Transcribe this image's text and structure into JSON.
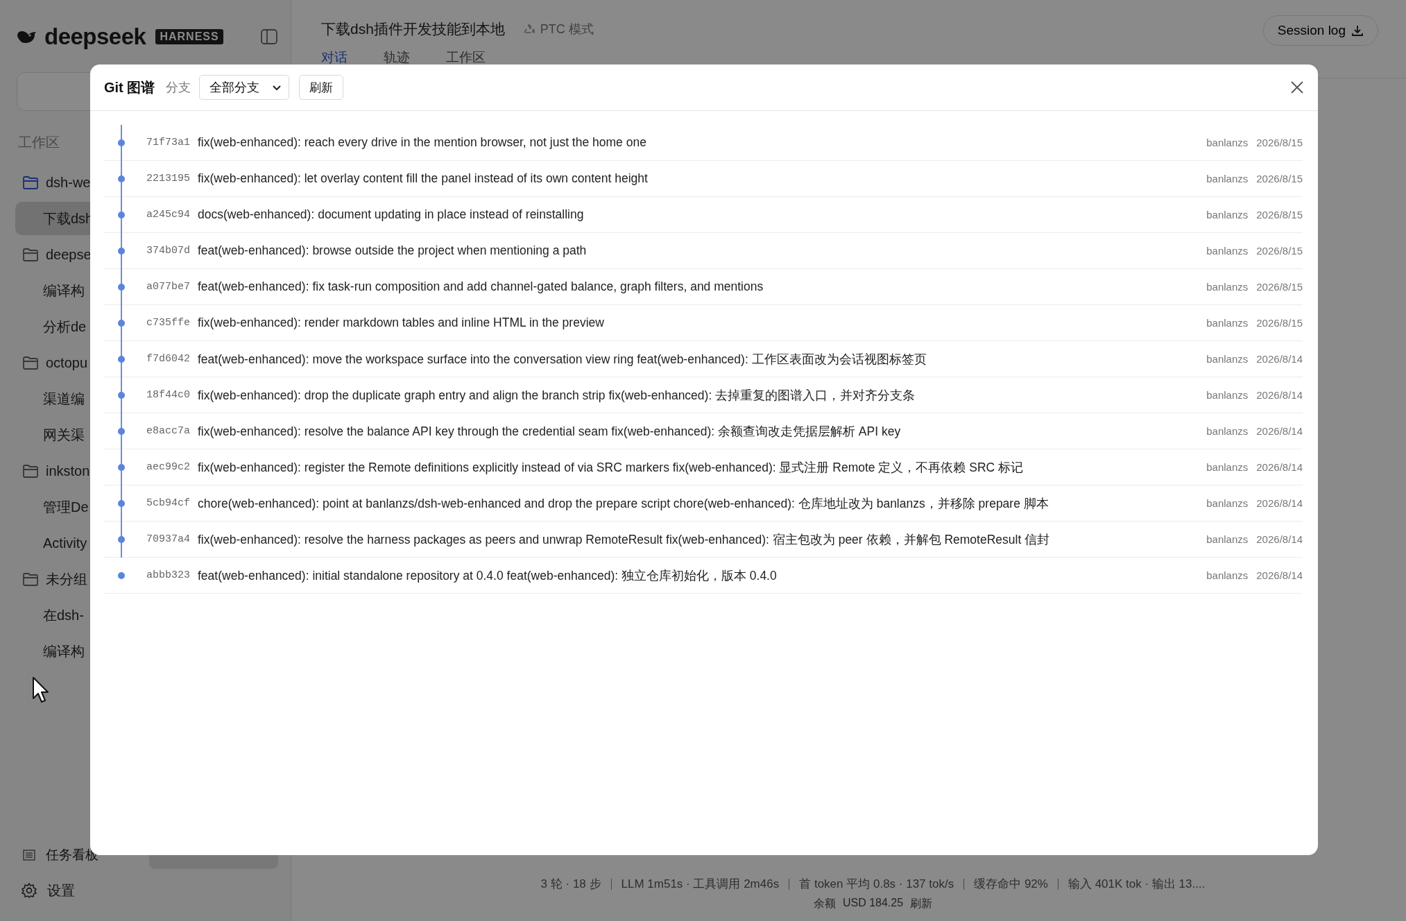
{
  "sidebar": {
    "logo": {
      "wordmark": "deepseek",
      "badge": "HARNESS"
    },
    "section_title": "工作区",
    "groups": [
      {
        "label": "dsh-we",
        "active": true,
        "children": [
          {
            "label": "下载dsh",
            "selected": true
          }
        ]
      },
      {
        "label": "deepse",
        "active": false,
        "children": [
          {
            "label": "编译构",
            "selected": false
          },
          {
            "label": "分析de",
            "selected": false
          }
        ]
      },
      {
        "label": "octopu",
        "active": false,
        "children": [
          {
            "label": "渠道编",
            "selected": false
          },
          {
            "label": "网关渠",
            "selected": false
          }
        ]
      },
      {
        "label": "inkston",
        "active": false,
        "children": [
          {
            "label": "管理De",
            "selected": false
          },
          {
            "label": "Activity",
            "selected": false
          }
        ]
      },
      {
        "label": "未分组",
        "active": false,
        "children": [
          {
            "label": "在dsh-",
            "selected": false
          },
          {
            "label": "编译构",
            "selected": false
          }
        ]
      }
    ],
    "footer": {
      "board": "任务看板",
      "git": {
        "selected": true
      },
      "settings": "设置"
    }
  },
  "header": {
    "title": "下载dsh插件开发技能到本地",
    "mode": "PTC 模式",
    "tabs": [
      {
        "label": "对话",
        "selected": true
      },
      {
        "label": "轨迹",
        "selected": false
      },
      {
        "label": "工作区",
        "selected": false
      }
    ],
    "session_log": "Session log"
  },
  "status": {
    "stats": [
      "3 轮 · 18 步",
      "LLM 1m51s · 工具调用 2m46s",
      "首 token 平均 0.8s · 137 tok/s",
      "缓存命中 92%",
      "输入 401K tok · 输出 13...."
    ],
    "balance_label": "余额",
    "balance": "USD 184.25",
    "refresh": "刷新"
  },
  "git_graph": {
    "title": "Git 图谱",
    "branch_label": "分支",
    "branch": "全部分支",
    "refresh": "刷新",
    "commits": [
      {
        "hash": "71f73a1",
        "message": "fix(web-enhanced): reach every drive in the mention browser, not just the home one",
        "author": "banlanzs",
        "date": "2026/8/15"
      },
      {
        "hash": "2213195",
        "message": "fix(web-enhanced): let overlay content fill the panel instead of its own content height",
        "author": "banlanzs",
        "date": "2026/8/15"
      },
      {
        "hash": "a245c94",
        "message": "docs(web-enhanced): document updating in place instead of reinstalling",
        "author": "banlanzs",
        "date": "2026/8/15"
      },
      {
        "hash": "374b07d",
        "message": "feat(web-enhanced): browse outside the project when mentioning a path",
        "author": "banlanzs",
        "date": "2026/8/15"
      },
      {
        "hash": "a077be7",
        "message": "feat(web-enhanced): fix task-run composition and add channel-gated balance, graph filters, and mentions",
        "author": "banlanzs",
        "date": "2026/8/15"
      },
      {
        "hash": "c735ffe",
        "message": "fix(web-enhanced): render markdown tables and inline HTML in the preview",
        "author": "banlanzs",
        "date": "2026/8/15"
      },
      {
        "hash": "f7d6042",
        "message": "feat(web-enhanced): move the workspace surface into the conversation view ring feat(web-enhanced): 工作区表面改为会话视图标签页",
        "author": "banlanzs",
        "date": "2026/8/14"
      },
      {
        "hash": "18f44c0",
        "message": "fix(web-enhanced): drop the duplicate graph entry and align the branch strip fix(web-enhanced): 去掉重复的图谱入口，并对齐分支条",
        "author": "banlanzs",
        "date": "2026/8/14"
      },
      {
        "hash": "e8acc7a",
        "message": "fix(web-enhanced): resolve the balance API key through the credential seam fix(web-enhanced): 余额查询改走凭据层解析 API key",
        "author": "banlanzs",
        "date": "2026/8/14"
      },
      {
        "hash": "aec99c2",
        "message": "fix(web-enhanced): register the Remote definitions explicitly instead of via SRC markers fix(web-enhanced): 显式注册 Remote 定义，不再依赖 SRC 标记",
        "author": "banlanzs",
        "date": "2026/8/14"
      },
      {
        "hash": "5cb94cf",
        "message": "chore(web-enhanced): point at banlanzs/dsh-web-enhanced and drop the prepare script chore(web-enhanced): 仓库地址改为 banlanzs，并移除 prepare 脚本",
        "author": "banlanzs",
        "date": "2026/8/14"
      },
      {
        "hash": "70937a4",
        "message": "fix(web-enhanced): resolve the harness packages as peers and unwrap RemoteResult fix(web-enhanced): 宿主包改为 peer 依赖，并解包 RemoteResult 信封",
        "author": "banlanzs",
        "date": "2026/8/14"
      },
      {
        "hash": "abbb323",
        "message": "feat(web-enhanced): initial standalone repository at 0.4.0 feat(web-enhanced): 独立仓库初始化，版本 0.4.0",
        "author": "banlanzs",
        "date": "2026/8/14"
      }
    ]
  }
}
